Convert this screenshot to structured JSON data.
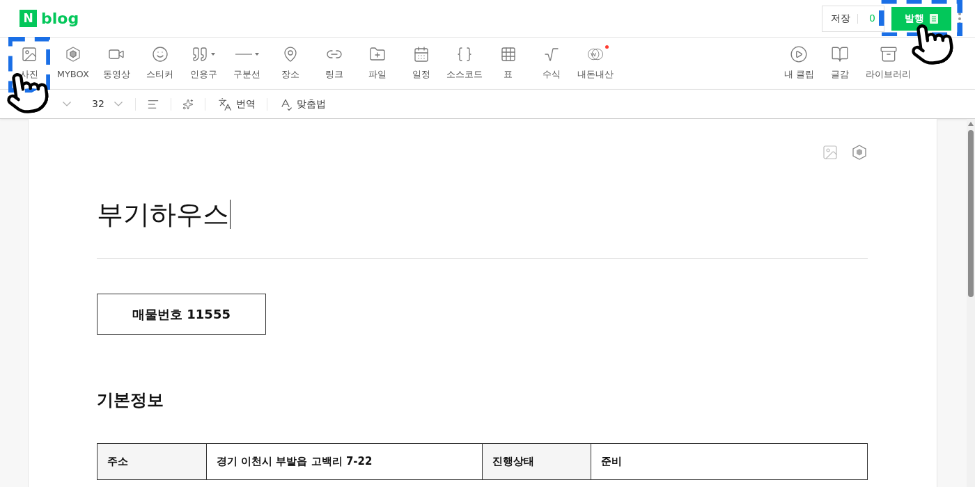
{
  "header": {
    "logo_mark": "N",
    "logo_text": "blog",
    "save_label": "저장",
    "save_count": "0",
    "publish_label": "발행"
  },
  "toolbar": {
    "left": [
      {
        "label": "사진",
        "has_menu": false,
        "badge": false
      },
      {
        "label": "MYBOX",
        "has_menu": false,
        "badge": false
      },
      {
        "label": "동영상",
        "has_menu": false,
        "badge": false
      },
      {
        "label": "스티커",
        "has_menu": false,
        "badge": false
      },
      {
        "label": "인용구",
        "has_menu": true,
        "badge": false
      },
      {
        "label": "구분선",
        "has_menu": true,
        "badge": false
      },
      {
        "label": "장소",
        "has_menu": false,
        "badge": false
      },
      {
        "label": "링크",
        "has_menu": false,
        "badge": false
      },
      {
        "label": "파일",
        "has_menu": false,
        "badge": false
      },
      {
        "label": "일정",
        "has_menu": false,
        "badge": false
      },
      {
        "label": "소스코드",
        "has_menu": false,
        "badge": false
      },
      {
        "label": "표",
        "has_menu": false,
        "badge": false
      },
      {
        "label": "수식",
        "has_menu": false,
        "badge": false
      },
      {
        "label": "내돈내산",
        "has_menu": false,
        "badge": true
      }
    ],
    "right": [
      {
        "label": "내 클립"
      },
      {
        "label": "글감"
      },
      {
        "label": "라이브러리"
      }
    ]
  },
  "format_bar": {
    "font_size": "32",
    "translate": "번역",
    "spellcheck": "맞춤법"
  },
  "document": {
    "title": "부기하우스",
    "listing_number": "매물번호 11555",
    "section_heading": "기본정보",
    "table": {
      "rows": [
        [
          "주소",
          "경기 이천시 부발읍 고백리 7-22",
          "진행상태",
          "준비"
        ]
      ]
    }
  }
}
